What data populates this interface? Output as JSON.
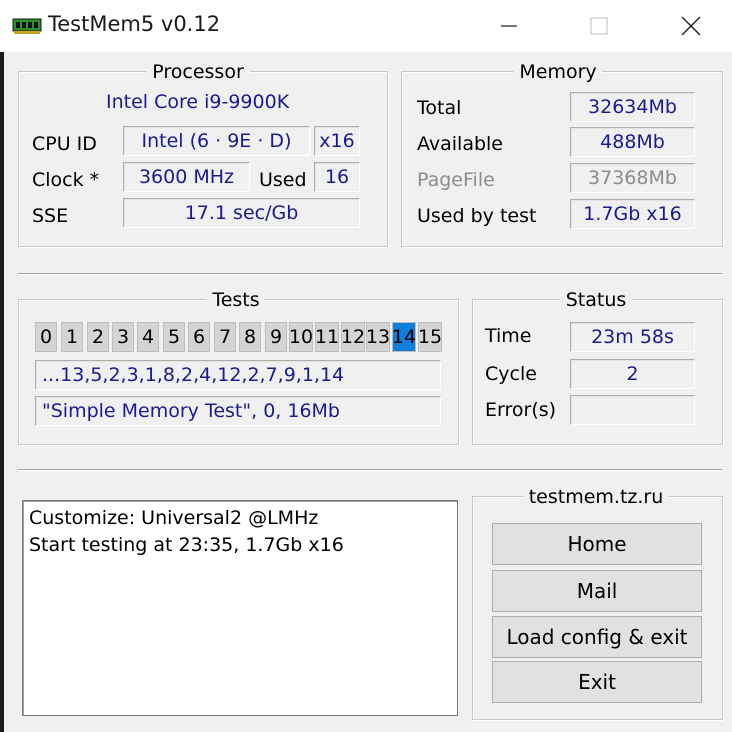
{
  "window": {
    "title": "TestMem5 v0.12",
    "icon": "memory-module-icon",
    "controls": [
      "minimize-icon",
      "maximize-icon",
      "close-icon"
    ]
  },
  "processor": {
    "legend": "Processor",
    "name": "Intel Core i9-9900K",
    "cpu_id_label": "CPU ID",
    "cpu_id_value": "Intel (6 · 9E · D)",
    "threads": "x16",
    "clock_label": "Clock *",
    "clock_value": "3600 MHz",
    "used_label": "Used",
    "used_value": "16",
    "sse_label": "SSE",
    "sse_value": "17.1 sec/Gb"
  },
  "memory": {
    "legend": "Memory",
    "total_label": "Total",
    "total_value": "32634Mb",
    "available_label": "Available",
    "available_value": "488Mb",
    "pagefile_label": "PageFile",
    "pagefile_value": "37368Mb",
    "used_by_test_label": "Used by test",
    "used_by_test_value": "1.7Gb x16"
  },
  "tests": {
    "legend": "Tests",
    "numbers": [
      "0",
      "1",
      "2",
      "3",
      "4",
      "5",
      "6",
      "7",
      "8",
      "9",
      "10",
      "11",
      "12",
      "13",
      "14",
      "15"
    ],
    "active_index": 14,
    "sequence": "...13,5,2,3,1,8,2,4,12,2,7,9,1,14",
    "current": "\"Simple Memory Test\", 0, 16Mb"
  },
  "status": {
    "legend": "Status",
    "time_label": "Time",
    "time_value": "23m 58s",
    "cycle_label": "Cycle",
    "cycle_value": "2",
    "errors_label": "Error(s)",
    "errors_value": ""
  },
  "log": {
    "lines": [
      "Customize: Universal2 @LMHz",
      "Start testing at 23:35, 1.7Gb x16"
    ]
  },
  "links": {
    "legend": "testmem.tz.ru",
    "home": "Home",
    "mail": "Mail",
    "load_config_exit": "Load config & exit",
    "exit": "Exit"
  },
  "colors": {
    "value_text": "#1b1b8f",
    "active_test": "#0f7fd9",
    "disabled_text": "#8c8c8c",
    "background": "#f0f0f0"
  }
}
